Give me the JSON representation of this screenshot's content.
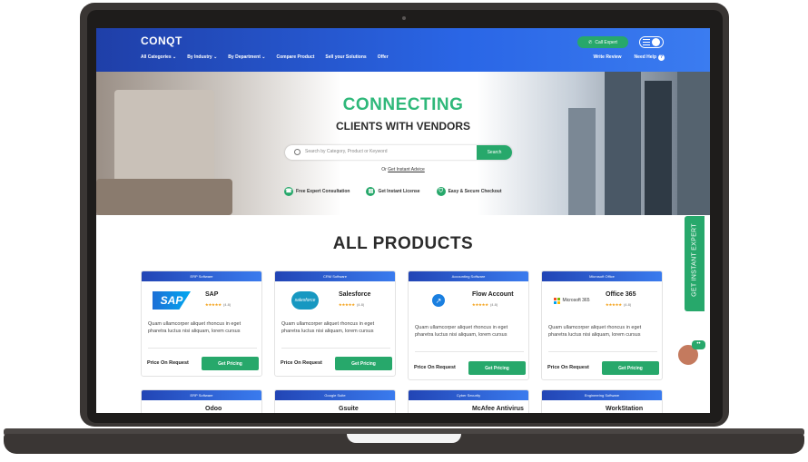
{
  "header": {
    "logo": "CONQT",
    "call_expert": "Call Expert",
    "nav_items": [
      "All Categories ⌄",
      "By Industry ⌄",
      "By Department ⌄",
      "Compare Product",
      "Sell your Solutions",
      "Offer"
    ],
    "write_review": "Write Review",
    "need_help": "Need Help",
    "help_icon": "?"
  },
  "hero": {
    "title": "CONNECTING",
    "subtitle": "CLIENTS WITH VENDORS",
    "search_placeholder": "Search by Category, Product or Keyword",
    "search_button": "Search",
    "or_text": "Or",
    "instant_advice": "Get Instant Advice",
    "features": [
      "Free Expert Consultation",
      "Get Instant License",
      "Easy & Secure Checkout"
    ]
  },
  "products": {
    "heading": "ALL PRODUCTS",
    "cards": [
      {
        "category": "ERP Software",
        "logo_text": "SAP",
        "name": "SAP",
        "rating": "(4.8)",
        "description": "Quam ullamcorper aliquet rhoncus in eget pharetra luctus nisi aliquam, lorem cursus",
        "price_label": "Price On Request",
        "button": "Get Pricing"
      },
      {
        "category": "CRM Software",
        "logo_text": "salesforce",
        "name": "Salesforce",
        "rating": "(4.8)",
        "description": "Quam ullamcorper aliquet rhoncus in eget pharetra luctus nisi aliquam, lorem cursus",
        "price_label": "Price On Request",
        "button": "Get Pricing"
      },
      {
        "category": "Accounting Software",
        "logo_text": "",
        "name": "Flow Account",
        "rating": "(4.8)",
        "description": "Quam ullamcorper aliquet rhoncus in eget pharetra luctus nisi aliquam, lorem cursus",
        "price_label": "Price On Request",
        "button": "Get Pricing"
      },
      {
        "category": "Microsoft Office",
        "logo_text": "Microsoft 365",
        "name": "Office 365",
        "rating": "(4.8)",
        "description": "Quam ullamcorper aliquet rhoncus in eget pharetra luctus nisi aliquam, lorem cursus",
        "price_label": "Price On Request",
        "button": "Get Pricing"
      }
    ],
    "second_row": [
      {
        "category": "ERP Software",
        "name": "Odoo"
      },
      {
        "category": "Google Suite",
        "name": "Gsuite"
      },
      {
        "category": "Cyber Security",
        "name": "McAfee Antivirus"
      },
      {
        "category": "Engineering Software",
        "name": "WorkStation"
      }
    ],
    "stars": "★★★★★"
  },
  "side_tab": {
    "label": "GET INSTANT EXPERT"
  },
  "chat": {
    "bubble": "••"
  },
  "colors": {
    "primary_blue": "#2a66e6",
    "accent_green": "#27a86b",
    "hero_green": "#2fb87a"
  }
}
